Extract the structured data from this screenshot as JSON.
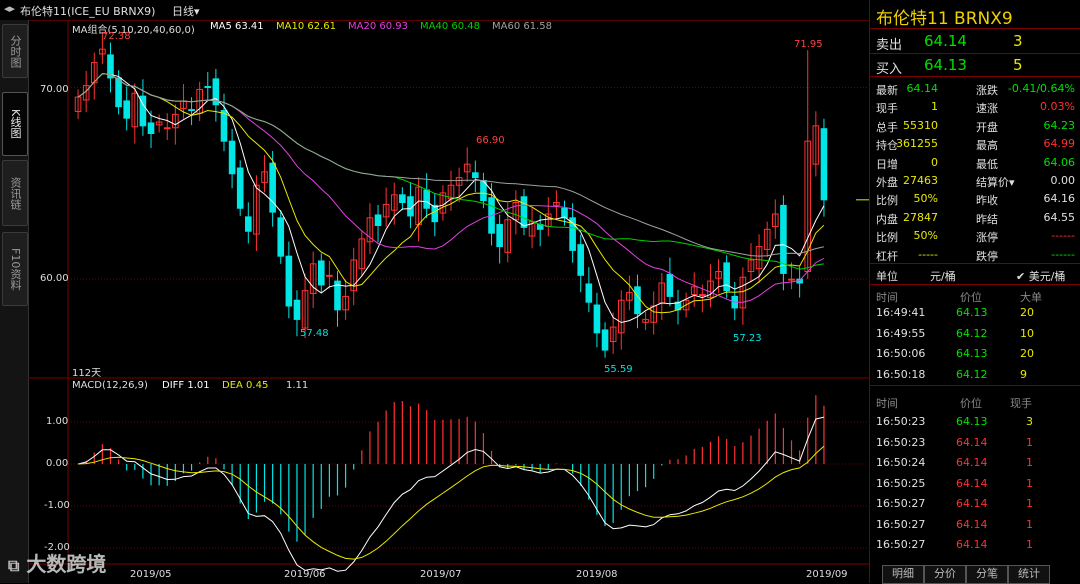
{
  "topbar": {
    "title": "布伦特11(ICE_EU BRNX9)",
    "period": "日线▾"
  },
  "left_tabs": [
    "分时图",
    "K线图",
    "资讯链",
    "F10资料"
  ],
  "ma_legend": {
    "group": "MA组合(5,10,20,40,60,0)",
    "ma5": "MA5 63.41",
    "ma10": "MA10 62.61",
    "ma20": "MA20 60.93",
    "ma40": "MA40 60.48",
    "ma60": "MA60 61.58"
  },
  "price_axis": [
    "70.00",
    "60.00"
  ],
  "annotations": {
    "high1": "72.38",
    "high2": "66.90",
    "high3": "71.95",
    "low1": "57.48",
    "low2": "55.59",
    "low3": "57.23",
    "days": "112天"
  },
  "macd_legend": {
    "label": "MACD(12,26,9)",
    "diff": "DIFF 1.01",
    "dea": "DEA 0.45",
    "macd": "1.11"
  },
  "macd_axis": [
    "1.00",
    "0.00",
    "-1.00",
    "-2.00"
  ],
  "date_axis": [
    "2019/05",
    "2019/06",
    "2019/07",
    "2019/08",
    "2019/09"
  ],
  "watermark": "大数跨境",
  "panel": {
    "header": "布伦特11  BRNX9",
    "sell": {
      "label": "卖出",
      "price": "64.14",
      "qty": "3"
    },
    "buy": {
      "label": "买入",
      "price": "64.13",
      "qty": "5"
    },
    "stats": [
      {
        "l1": "最新",
        "v1": "64.14",
        "c1": "g",
        "l2": "涨跌",
        "v2": "-0.41/0.64%",
        "c2": "g"
      },
      {
        "l1": "现手",
        "v1": "1",
        "c1": "y",
        "l2": "速涨",
        "v2": "0.03%",
        "c2": "r"
      },
      {
        "l1": "总手",
        "v1": "55310",
        "c1": "y",
        "l2": "开盘",
        "v2": "64.23",
        "c2": "g"
      },
      {
        "l1": "持仓",
        "v1": "361255",
        "c1": "y",
        "l2": "最高",
        "v2": "64.99",
        "c2": "r"
      },
      {
        "l1": "日增",
        "v1": "0",
        "c1": "y",
        "l2": "最低",
        "v2": "64.06",
        "c2": "g"
      },
      {
        "l1": "外盘",
        "v1": "27463",
        "c1": "y",
        "l2": "结算价▾",
        "v2": "0.00",
        "c2": "w"
      },
      {
        "l1": "比例",
        "v1": "50%",
        "c1": "y",
        "l2": "昨收",
        "v2": "64.16",
        "c2": "w"
      },
      {
        "l1": "内盘",
        "v1": "27847",
        "c1": "y",
        "l2": "昨结",
        "v2": "64.55",
        "c2": "w"
      },
      {
        "l1": "比例",
        "v1": "50%",
        "c1": "y",
        "l2": "涨停",
        "v2": "------",
        "c2": "r"
      },
      {
        "l1": "杠杆",
        "v1": "-----",
        "c1": "y",
        "l2": "跌停",
        "v2": "------",
        "c2": "g"
      }
    ],
    "unit": {
      "label": "单位",
      "value": "元/桶",
      "alt": "✔ 美元/桶"
    },
    "big_orders": {
      "headers": [
        "时间",
        "价位",
        "大单"
      ],
      "rows": [
        [
          "16:49:41",
          "64.13",
          "20"
        ],
        [
          "16:49:55",
          "64.12",
          "10"
        ],
        [
          "16:50:06",
          "64.13",
          "20"
        ],
        [
          "16:50:18",
          "64.12",
          "9"
        ]
      ]
    },
    "ticks": {
      "headers": [
        "时间",
        "价位",
        "现手"
      ],
      "rows": [
        [
          "16:50:23",
          "64.13",
          "3"
        ],
        [
          "16:50:23",
          "64.14",
          "1"
        ],
        [
          "16:50:24",
          "64.14",
          "1"
        ],
        [
          "16:50:25",
          "64.14",
          "1"
        ],
        [
          "16:50:27",
          "64.14",
          "1"
        ],
        [
          "16:50:27",
          "64.14",
          "1"
        ],
        [
          "16:50:27",
          "64.14",
          "1"
        ]
      ]
    },
    "bottom_tabs": [
      "明细",
      "分价",
      "分笔",
      "统计"
    ]
  },
  "colors": {
    "up": "#ff3232",
    "down": "#00e5e5",
    "ma5": "#ffffff",
    "ma10": "#e8e800",
    "ma20": "#e040e0",
    "ma40": "#00d000",
    "ma60": "#a0a0a0",
    "grid": "#6a0000"
  },
  "chart_data": {
    "type": "candlestick",
    "ylim": [
      55,
      73
    ],
    "close_series": [
      69.5,
      70.1,
      71.3,
      72.0,
      70.5,
      69.0,
      68.4,
      69.7,
      68.0,
      67.6,
      68.2,
      67.9,
      68.6,
      69.3,
      68.8,
      69.9,
      70.0,
      69.1,
      67.2,
      65.5,
      63.7,
      62.5,
      64.9,
      65.6,
      63.5,
      61.2,
      58.6,
      57.9,
      59.4,
      60.8,
      59.7,
      60.2,
      58.4,
      59.1,
      61.0,
      62.1,
      63.2,
      62.8,
      63.9,
      64.4,
      64.0,
      63.3,
      64.8,
      63.7,
      63.0,
      64.5,
      64.9,
      65.3,
      66.0,
      65.3,
      64.1,
      62.4,
      61.7,
      63.1,
      64.0,
      62.7,
      63.0,
      62.6,
      63.4,
      64.0,
      63.2,
      61.5,
      60.2,
      58.8,
      57.2,
      56.3,
      57.5,
      58.9,
      59.3,
      58.2,
      57.9,
      58.6,
      59.8,
      59.1,
      58.4,
      58.9,
      59.6,
      59.2,
      59.9,
      60.4,
      59.4,
      58.5,
      60.1,
      61.0,
      61.7,
      62.6,
      63.4,
      60.3,
      60.0,
      59.8,
      67.2,
      68.0,
      64.14
    ]
  }
}
